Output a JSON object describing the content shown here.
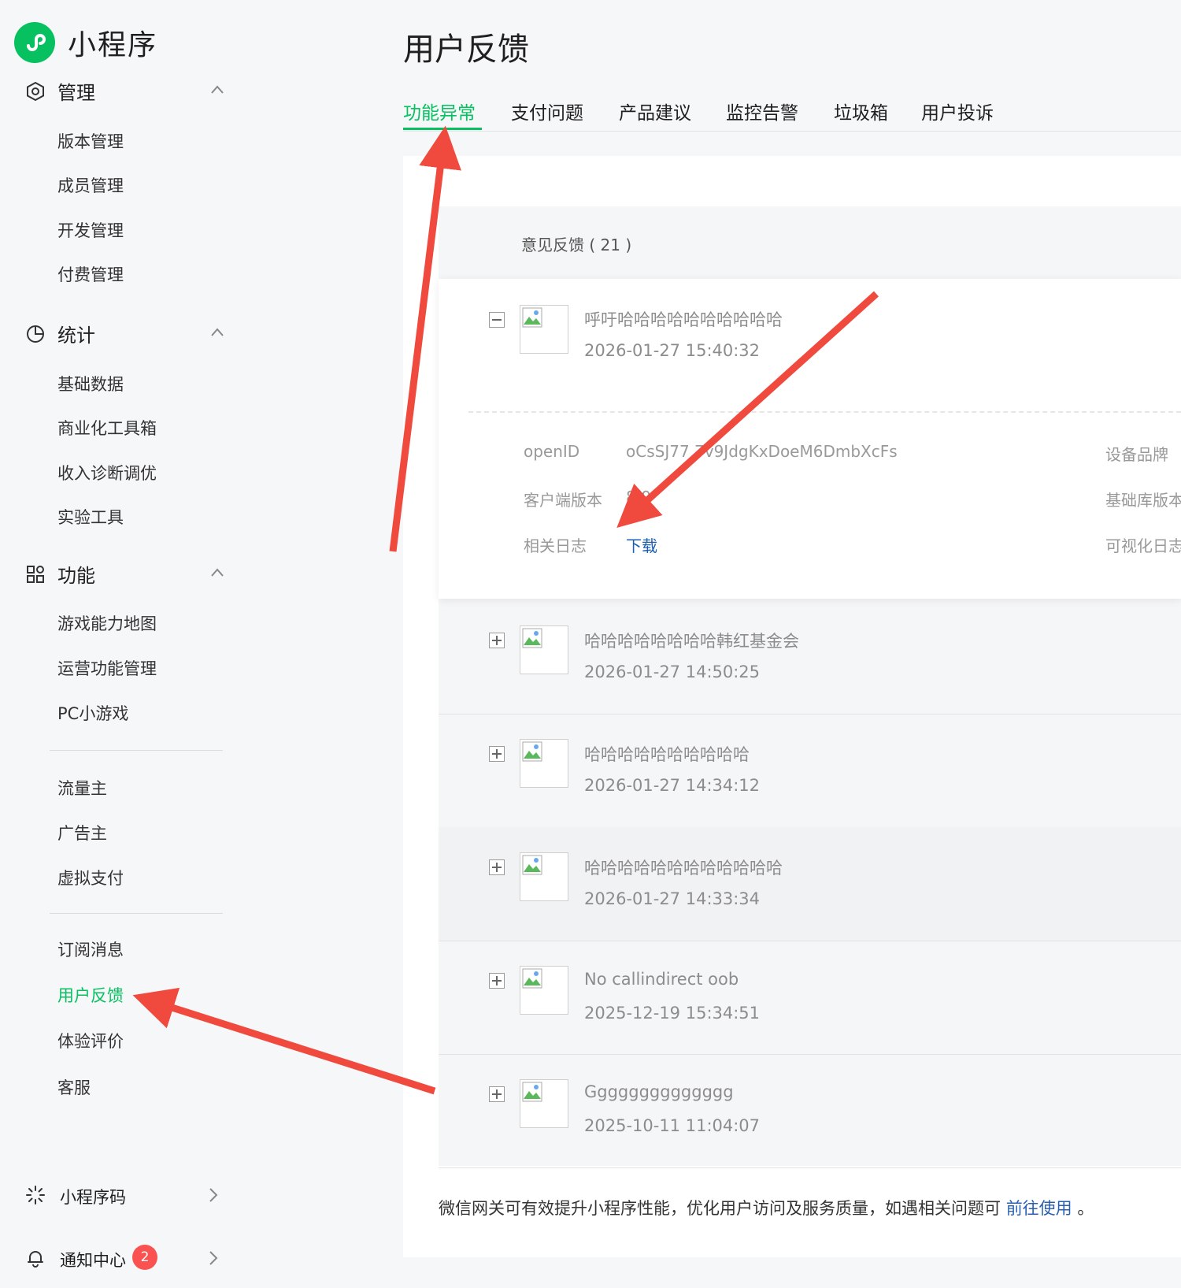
{
  "app": {
    "title": "小程序"
  },
  "sidebar": {
    "groups": [
      {
        "label": "管理",
        "icon": "hexagon-gear-icon",
        "items": [
          "版本管理",
          "成员管理",
          "开发管理",
          "付费管理"
        ]
      },
      {
        "label": "统计",
        "icon": "pie-chart-icon",
        "items": [
          "基础数据",
          "商业化工具箱",
          "收入诊断调优",
          "实验工具"
        ]
      },
      {
        "label": "功能",
        "icon": "grid-icon",
        "items": [
          "游戏能力地图",
          "运营功能管理",
          "PC小游戏",
          "流量主",
          "广告主",
          "虚拟支付",
          "订阅消息",
          "用户反馈",
          "体验评价",
          "客服"
        ]
      }
    ],
    "active_item": "用户反馈",
    "bottom": [
      {
        "label": "小程序码",
        "icon": "qr-sparkle-icon"
      },
      {
        "label": "通知中心",
        "icon": "bell-icon",
        "badge": "2"
      }
    ]
  },
  "page": {
    "title": "用户反馈",
    "tabs": [
      "功能异常",
      "支付问题",
      "产品建议",
      "监控告警",
      "垃圾箱",
      "用户投诉"
    ],
    "active_tab": "功能异常"
  },
  "feedback": {
    "count_label": "意见反馈 ( 21 )",
    "expanded": {
      "title": "呼吁哈哈哈哈哈哈哈哈哈哈",
      "time": "2026-01-27 15:40:32",
      "details": {
        "openid_label": "openID",
        "openid_value": "oCsSJ77  7v9JdgKxDoeM6DmbXcFs",
        "client_version_label": "客户端版本",
        "client_version_value": "8.0",
        "log_label": "相关日志",
        "log_link": "下载",
        "device_brand_label": "设备品牌",
        "base_lib_label": "基础库版本",
        "visual_log_label": "可视化日志"
      }
    },
    "items": [
      {
        "title": "哈哈哈哈哈哈哈哈韩红基金会",
        "time": "2026-01-27 14:50:25"
      },
      {
        "title": "哈哈哈哈哈哈哈哈哈哈",
        "time": "2026-01-27 14:34:12"
      },
      {
        "title": "哈哈哈哈哈哈哈哈哈哈哈哈",
        "time": "2026-01-27 14:33:34"
      },
      {
        "title": "No callindirect oob",
        "time": "2025-12-19 15:34:51"
      },
      {
        "title": "Gggggggggggggg",
        "time": "2025-10-11 11:04:07"
      }
    ]
  },
  "footer": {
    "note": "微信网关可有效提升小程序性能，优化用户访问及服务质量，如遇相关问题可",
    "link": "前往使用",
    "end": "。"
  },
  "colors": {
    "accent": "#07c160",
    "annotation": "#f04a3e",
    "link": "#1a5fb4",
    "badge": "#fa5151"
  }
}
